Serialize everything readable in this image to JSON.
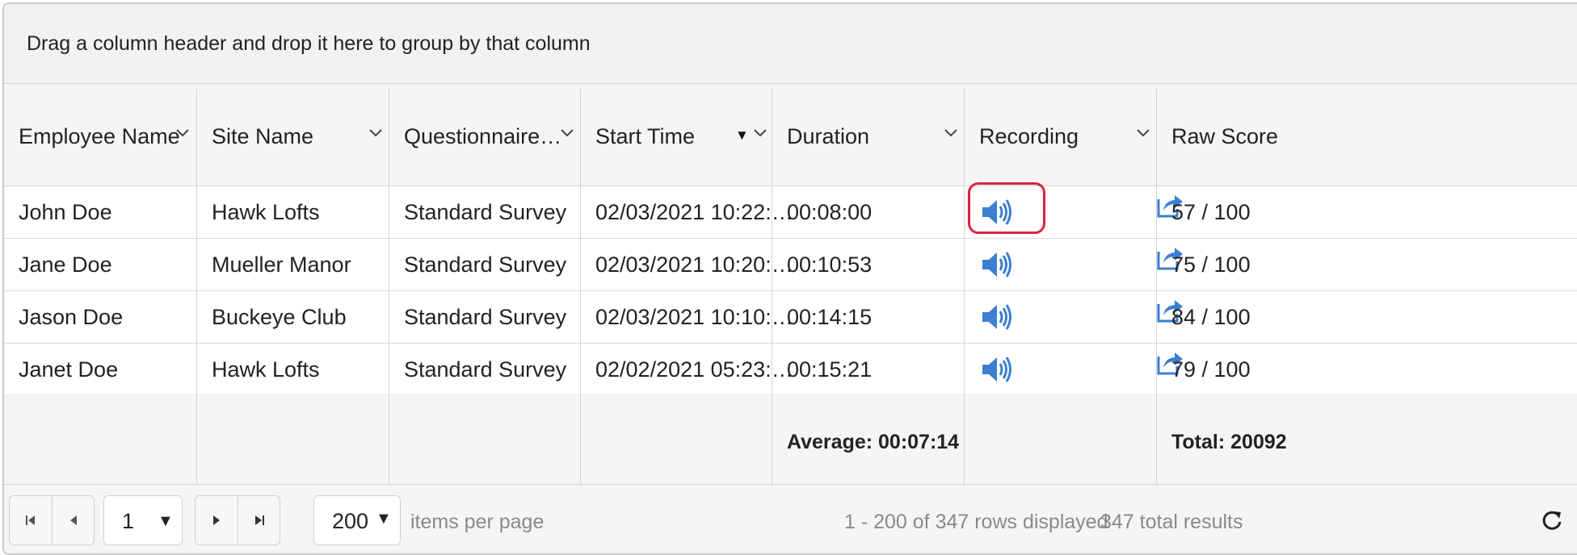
{
  "group_bar": {
    "text": "Drag a column header and drop it here to group by that column"
  },
  "columns": [
    {
      "label": "Employee Name"
    },
    {
      "label": "Site Name"
    },
    {
      "label": "Questionnaire…"
    },
    {
      "label": "Start Time"
    },
    {
      "label": "Duration"
    },
    {
      "label": "Recording"
    },
    {
      "label": "Raw Score"
    }
  ],
  "rows": [
    {
      "employee": "John Doe",
      "site": "Hawk Lofts",
      "questionnaire": "Standard Survey",
      "start_time": "02/03/2021 10:22:…",
      "duration": "00:08:00",
      "raw_score": "57 / 100"
    },
    {
      "employee": "Jane Doe",
      "site": "Mueller Manor",
      "questionnaire": "Standard Survey",
      "start_time": "02/03/2021 10:20:…",
      "duration": "00:10:53",
      "raw_score": "75 / 100"
    },
    {
      "employee": "Jason Doe",
      "site": "Buckeye Club",
      "questionnaire": "Standard Survey",
      "start_time": "02/03/2021 10:10:…",
      "duration": "00:14:15",
      "raw_score": "84 / 100"
    },
    {
      "employee": "Janet Doe",
      "site": "Hawk Lofts",
      "questionnaire": "Standard Survey",
      "start_time": "02/02/2021 05:23:…",
      "duration": "00:15:21",
      "raw_score": "79 / 100"
    }
  ],
  "footer": {
    "duration_aggregate": "Average: 00:07:14",
    "raw_score_aggregate": "Total: 20092"
  },
  "pager": {
    "current_page": "1",
    "page_size": "200",
    "items_per_page_label": "items per page",
    "rows_displayed": "1 - 200 of 347 rows displayed",
    "total_results": "347 total results"
  },
  "icons": {
    "speaker": "speaker-icon",
    "share": "share-icon",
    "refresh": "refresh-icon",
    "sort_desc": "sort-descending-icon",
    "column_menu": "chevron-down-icon"
  },
  "colors": {
    "icon_blue": "#3a7fd1",
    "highlight": "#e0203f",
    "header_bg": "#f5f5f5"
  }
}
